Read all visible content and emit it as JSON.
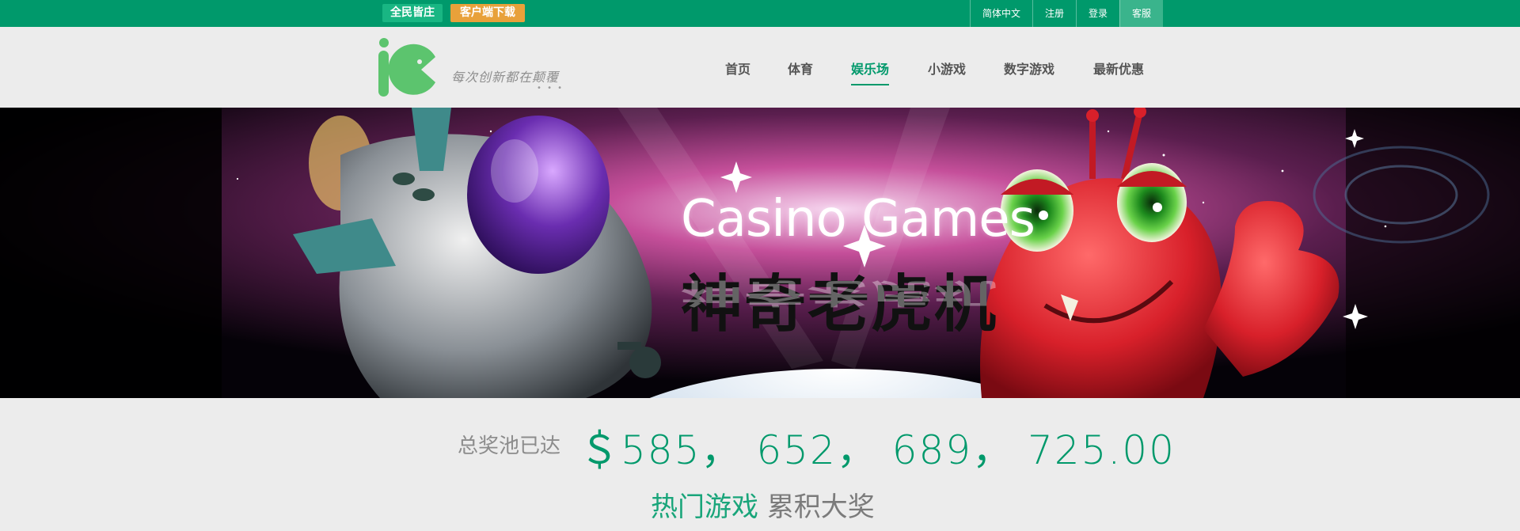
{
  "topbar": {
    "badge_all": "全民皆庄",
    "badge_download": "客户端下载",
    "links": [
      "简体中文",
      "注册",
      "登录",
      "客服"
    ]
  },
  "header": {
    "slogan": "每次创新都在颠覆",
    "slogan_dots": "• • •",
    "nav": [
      "首页",
      "体育",
      "娱乐场",
      "小游戏",
      "数字游戏",
      "最新优惠"
    ],
    "nav_active": "娱乐场"
  },
  "banner": {
    "title_en": "Casino Games",
    "title_cn": "神奇老虎机"
  },
  "jackpot": {
    "label": "总奖池已达",
    "amount": "＄585， 652， 689， 725.00",
    "sub_hot": "热门游戏",
    "sub_acc": "累积大奖"
  },
  "colors": {
    "brand_green": "#00996b",
    "badge_orange": "#e8a13a",
    "logo_green": "#5cc46e"
  }
}
